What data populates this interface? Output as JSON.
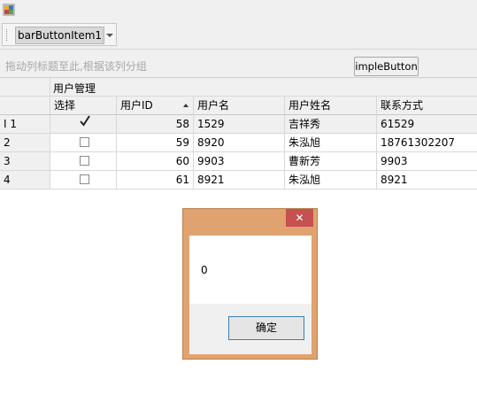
{
  "toolbar": {
    "bar_item_label": "barButtonItem1"
  },
  "group_panel": {
    "hint": "拖动列标题至此,根据该列分组",
    "simple_button_label": "impleButton"
  },
  "band": {
    "label": "用户管理"
  },
  "columns": [
    "选择",
    "用户ID",
    "用户名",
    "用户姓名",
    "联系方式"
  ],
  "rows": [
    {
      "indicator": "I 1",
      "checked": true,
      "id": "58",
      "username": "1529",
      "fullname": "吉祥秀",
      "contact": "61529"
    },
    {
      "indicator": "2",
      "checked": false,
      "id": "59",
      "username": "8920",
      "fullname": "朱泓旭",
      "contact": "18761302207"
    },
    {
      "indicator": "3",
      "checked": false,
      "id": "60",
      "username": "9903",
      "fullname": "曹新芳",
      "contact": "9903"
    },
    {
      "indicator": "4",
      "checked": false,
      "id": "61",
      "username": "8921",
      "fullname": "朱泓旭",
      "contact": "8921"
    }
  ],
  "dialog": {
    "close_glyph": "✕",
    "message": "0",
    "ok_label": "确定"
  },
  "icons": {
    "app": "app-icon",
    "sort": "sort-ascending-icon",
    "dropdown": "chevron-down-icon",
    "check": "checkmark-icon"
  },
  "colors": {
    "dialog_frame": "#e0a36f",
    "close_button": "#c75050",
    "ok_border": "#3c7fb1"
  }
}
